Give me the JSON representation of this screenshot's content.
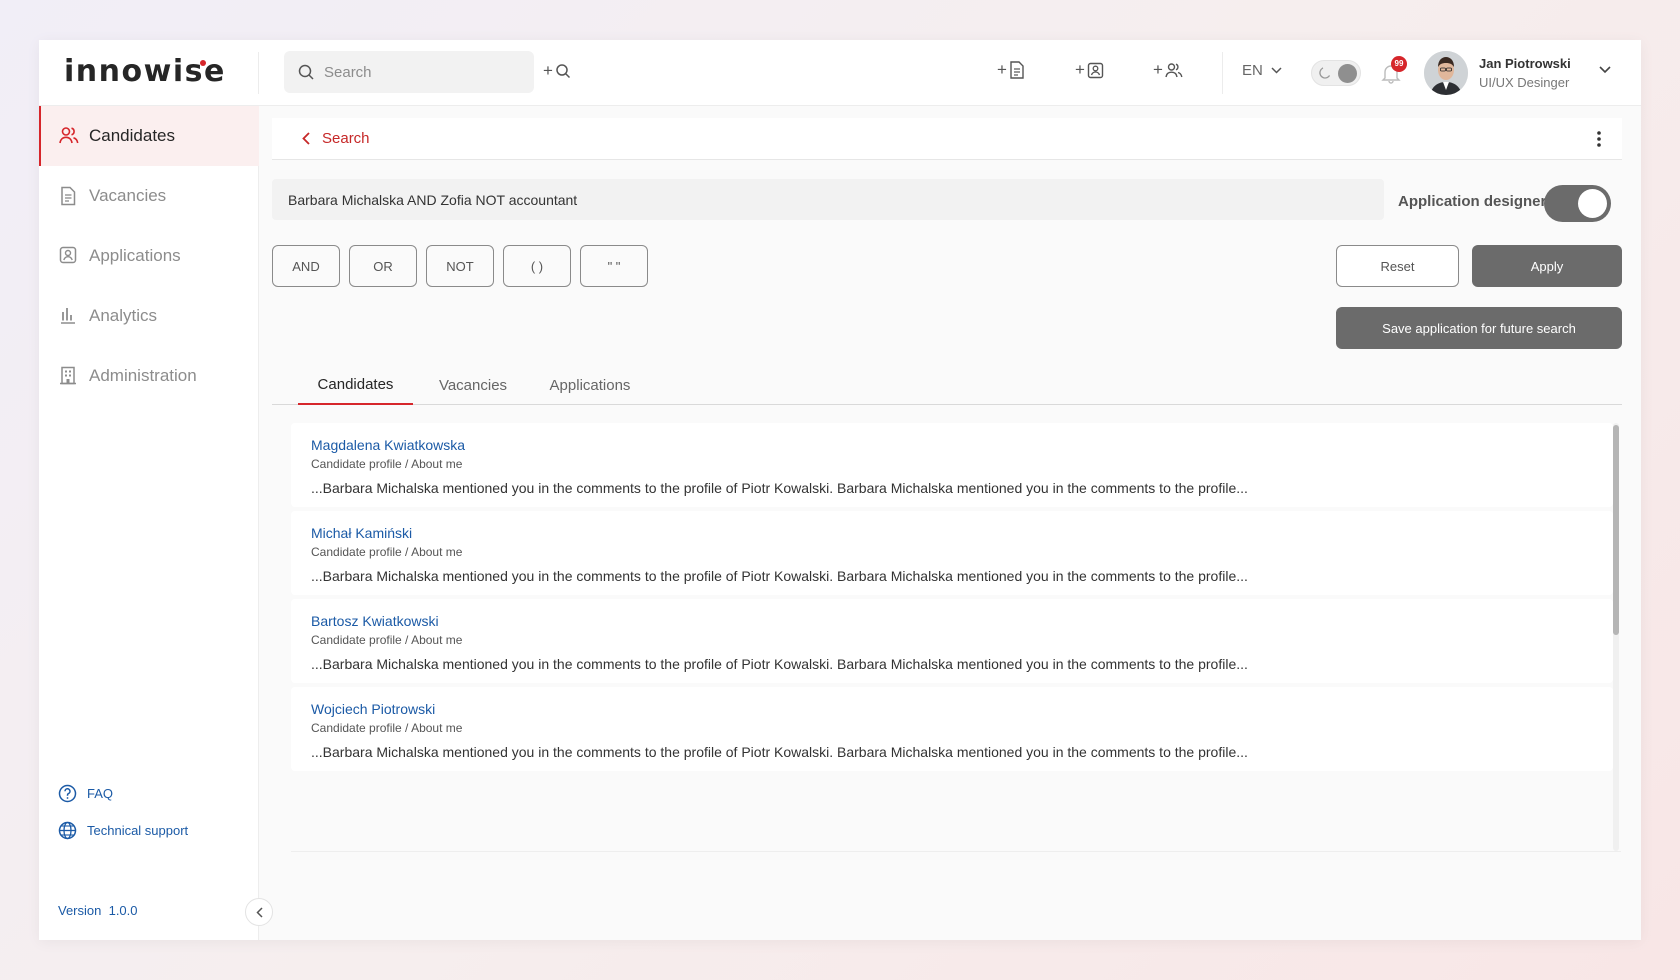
{
  "header": {
    "logo_text": "innowise",
    "search_placeholder": "Search",
    "advanced_search_label": "+",
    "add_document_label": "+",
    "add_application_label": "+",
    "add_candidate_label": "+",
    "language": "EN",
    "notification_count": "99",
    "user": {
      "name": "Jan Piotrowski",
      "role": "UI/UX Desinger"
    }
  },
  "sidebar": {
    "items": [
      {
        "label": "Candidates",
        "icon": "users-icon",
        "active": true
      },
      {
        "label": "Vacancies",
        "icon": "document-icon"
      },
      {
        "label": "Applications",
        "icon": "badge-icon"
      },
      {
        "label": "Analytics",
        "icon": "bar-chart-icon"
      },
      {
        "label": "Administration",
        "icon": "building-icon"
      }
    ],
    "faq": "FAQ",
    "support": "Technical support",
    "version": "Version  1.0.0"
  },
  "subheader": {
    "back_label": "Search"
  },
  "query": {
    "text": "Barbara Michalska AND Zofia NOT accountant",
    "designer_label": "Application designer"
  },
  "operators": [
    "AND",
    "OR",
    "NOT",
    "( )",
    "\" \""
  ],
  "actions": {
    "reset": "Reset",
    "apply": "Apply",
    "save": "Save application for future search"
  },
  "tabs": [
    "Candidates",
    "Vacancies",
    "Applications"
  ],
  "results": [
    {
      "name": "Magdalena Kwiatkowska",
      "path": "Candidate profile / About me",
      "snippet": "...Barbara Michalska mentioned you in the comments to the profile of Piotr Kowalski. Barbara Michalska mentioned you in the comments to the profile..."
    },
    {
      "name": "Michał Kamiński",
      "path": "Candidate profile / About me",
      "snippet": "...Barbara Michalska mentioned you in the comments to the profile of Piotr Kowalski. Barbara Michalska mentioned you in the comments to the profile..."
    },
    {
      "name": "Bartosz Kwiatkowski",
      "path": "Candidate profile / About me",
      "snippet": "...Barbara Michalska mentioned you in the comments to the profile of Piotr Kowalski. Barbara Michalska mentioned you in the comments to the profile..."
    },
    {
      "name": "Wojciech Piotrowski",
      "path": "Candidate profile / About me",
      "snippet": "...Barbara Michalska mentioned you in the comments to the profile of Piotr Kowalski. Barbara Michalska mentioned you in the comments to the profile..."
    }
  ],
  "colors": {
    "accent": "#d6262b",
    "link": "#1b5aa6",
    "button_dark": "#6b6b6b"
  }
}
